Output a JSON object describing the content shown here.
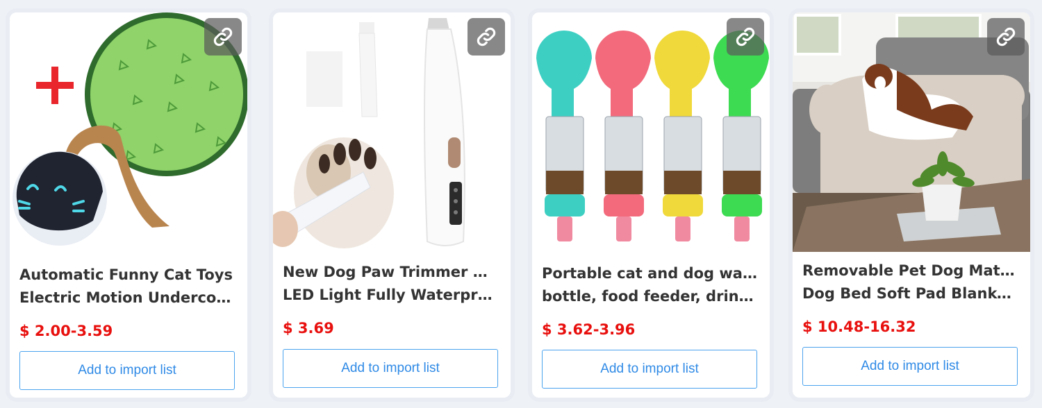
{
  "products": [
    {
      "title_line1": "Automatic Funny Cat Toys",
      "title_line2": "Electric Motion Undercover Mouse",
      "price": "$ 2.00-3.59",
      "button_label": "Add to import list",
      "image_icon": "cat-toy-product-image"
    },
    {
      "title_line1": "New Dog Paw Trimmer with",
      "title_line2": "LED Light Fully Waterproof Pet",
      "price": "$ 3.69",
      "button_label": "Add to import list",
      "image_icon": "paw-trimmer-product-image"
    },
    {
      "title_line1": "Portable cat and dog water",
      "title_line2": "bottle, food feeder, drinking cup",
      "price": "$ 3.62-3.96",
      "button_label": "Add to import list",
      "image_icon": "water-bottle-product-image"
    },
    {
      "title_line1": "Removable Pet Dog Mat Sofa",
      "title_line2": "Dog Bed Soft Pad Blanket Cushion",
      "price": "$ 10.48-16.32",
      "button_label": "Add to import list",
      "image_icon": "dog-sofa-mat-product-image"
    }
  ],
  "colors": {
    "price": "#e8100e",
    "button_text": "#2f8ae6",
    "button_border": "#4aa3ee",
    "title": "#333333"
  },
  "icons": {
    "link": "link-icon"
  }
}
